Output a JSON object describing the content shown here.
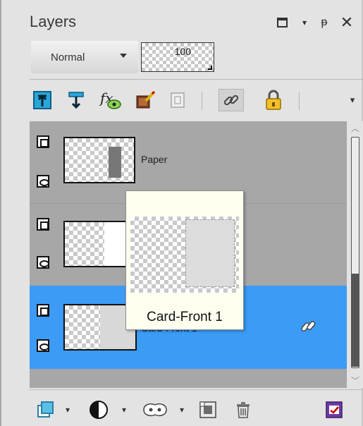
{
  "panel": {
    "title": "Layers"
  },
  "blend": {
    "mode": "Normal",
    "opacity": "100"
  },
  "layers": [
    {
      "name": "Paper",
      "selected": false,
      "linked": false
    },
    {
      "name": "",
      "selected": false,
      "linked": false
    },
    {
      "name": "Card-Front 1",
      "selected": true,
      "linked": true
    }
  ],
  "tooltip": {
    "label": "Card-Front 1"
  },
  "colors": {
    "selection": "#3b9bf5",
    "list_bg": "#a7a7a7",
    "tooltip_bg": "#fffff0"
  }
}
